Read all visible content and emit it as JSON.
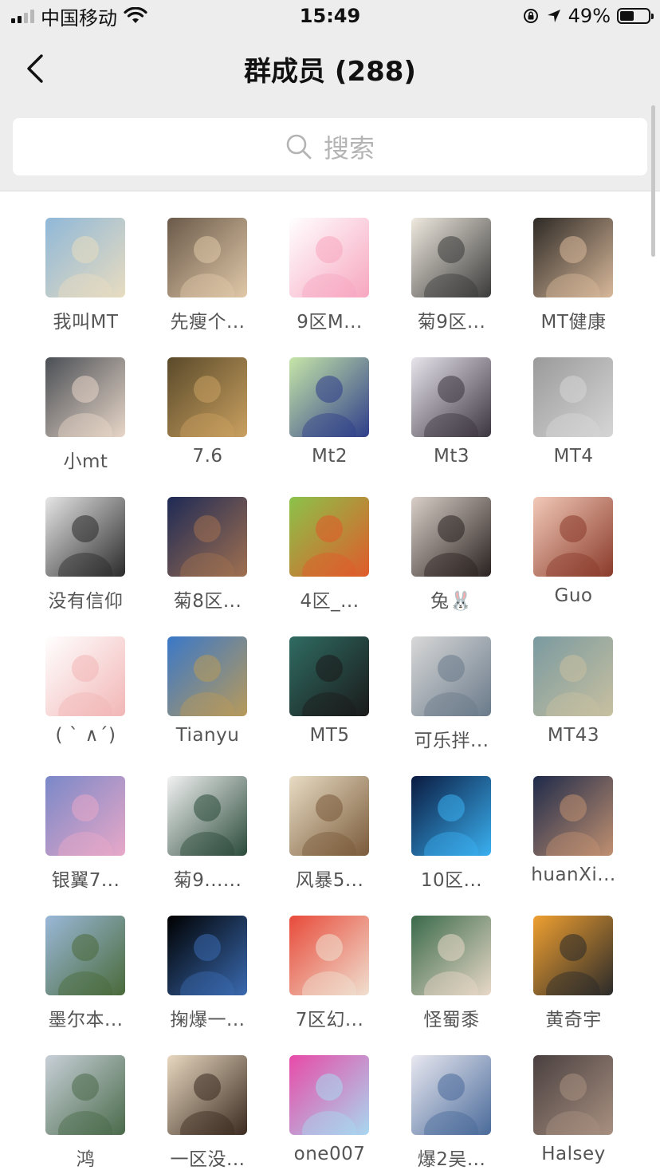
{
  "status_bar": {
    "carrier": "中国移动",
    "time": "15:49",
    "battery": "49%",
    "battery_level": 0.49,
    "signal_bars": 4,
    "signal_active": 2,
    "icons": [
      "signal-icon",
      "wifi-icon",
      "orientation-lock-icon",
      "location-arrow-icon",
      "battery-icon"
    ]
  },
  "nav": {
    "title": "群成员 (288)",
    "back_icon": "chevron-left-icon"
  },
  "search": {
    "placeholder": "搜索",
    "icon": "search-icon"
  },
  "members": [
    {
      "name": "我叫MT",
      "avatar": "white-sports-car",
      "colors": [
        "#8fb8d8",
        "#e8dcc0"
      ]
    },
    {
      "name": "先瘦个...",
      "avatar": "child-at-restaurant",
      "colors": [
        "#6b5a4a",
        "#e0c8a8"
      ]
    },
    {
      "name": "9区M...",
      "avatar": "pink-starfish-cartoon",
      "colors": [
        "#ffffff",
        "#f7a6c0"
      ]
    },
    {
      "name": "菊9区...",
      "avatar": "sleeping-cartoon-kid",
      "colors": [
        "#efe9df",
        "#3a3a3a"
      ]
    },
    {
      "name": "MT健康",
      "avatar": "man-eating-china-flag",
      "colors": [
        "#2e2a26",
        "#d8b89a"
      ]
    },
    {
      "name": "小mt",
      "avatar": "blue-hair-person",
      "colors": [
        "#4a4f55",
        "#e8d6c8"
      ]
    },
    {
      "name": "7.6",
      "avatar": "dog-on-grass",
      "colors": [
        "#5a4a2a",
        "#c9a060"
      ]
    },
    {
      "name": "Mt2",
      "avatar": "police-bear-meme",
      "colors": [
        "#c6e6a8",
        "#2e3d8a"
      ]
    },
    {
      "name": "Mt3",
      "avatar": "anime-character",
      "colors": [
        "#e8e4ec",
        "#3b3540"
      ]
    },
    {
      "name": "MT4",
      "avatar": "bw-man-photo",
      "colors": [
        "#9a9a9a",
        "#d6d6d6"
      ]
    },
    {
      "name": "没有信仰",
      "avatar": "bw-portrait",
      "colors": [
        "#e6e6e6",
        "#2a2a2a"
      ]
    },
    {
      "name": "菊8区...",
      "avatar": "person-on-stairs",
      "colors": [
        "#1e2a55",
        "#a07050"
      ]
    },
    {
      "name": "4区_...",
      "avatar": "straw-hat-on-grass",
      "colors": [
        "#8bc34a",
        "#e05a2a"
      ]
    },
    {
      "name": "兔🐰",
      "avatar": "girl-with-braids",
      "colors": [
        "#d9cfc8",
        "#2a2220"
      ]
    },
    {
      "name": "Guo",
      "avatar": "anime-girl-sticker",
      "colors": [
        "#f2c9b8",
        "#8a3a2a"
      ]
    },
    {
      "name": "( ` ∧´)",
      "avatar": "cartoon-pig",
      "colors": [
        "#ffffff",
        "#f2b6b6"
      ]
    },
    {
      "name": "Tianyu",
      "avatar": "sandstone-building",
      "colors": [
        "#3a78c8",
        "#b89a5a"
      ]
    },
    {
      "name": "MT5",
      "avatar": "anime-boy",
      "colors": [
        "#2f6b62",
        "#1a1a1a"
      ]
    },
    {
      "name": "可乐拌...",
      "avatar": "person-with-mask",
      "colors": [
        "#d8d8d8",
        "#6a7a8a"
      ]
    },
    {
      "name": "MT43",
      "avatar": "person-on-cliff-sea",
      "colors": [
        "#7a9aa0",
        "#c8c0a0"
      ]
    },
    {
      "name": "银翼7...",
      "avatar": "green-cartoon-character",
      "colors": [
        "#7a88c8",
        "#e8a8c8"
      ]
    },
    {
      "name": "菊9......",
      "avatar": "joker-illustration",
      "colors": [
        "#f2f2f2",
        "#2a4a3a"
      ]
    },
    {
      "name": "风暴5...",
      "avatar": "man-with-camera",
      "colors": [
        "#e8dcc4",
        "#7a5a3a"
      ]
    },
    {
      "name": "10区...",
      "avatar": "blue-water-china-flag",
      "colors": [
        "#0a1a40",
        "#3ab0f0"
      ]
    },
    {
      "name": "huanXi...",
      "avatar": "night-clouds-moon",
      "colors": [
        "#1e2a4a",
        "#c09070"
      ]
    },
    {
      "name": "墨尔本...",
      "avatar": "white-car-field",
      "colors": [
        "#9ab8d8",
        "#4a6a3a"
      ]
    },
    {
      "name": "掬爆一...",
      "avatar": "earth-from-space",
      "colors": [
        "#000000",
        "#3a6ab0"
      ]
    },
    {
      "name": "7区幻...",
      "avatar": "child-red-background",
      "colors": [
        "#e84a3a",
        "#f0e0d0"
      ]
    },
    {
      "name": "怪蜀黍",
      "avatar": "glasses-man-drawing",
      "colors": [
        "#3a6a4a",
        "#e8d8c8"
      ]
    },
    {
      "name": "黄奇宇",
      "avatar": "black-cat-sunburst",
      "colors": [
        "#f0a030",
        "#2a2a2a"
      ]
    },
    {
      "name": "鸿",
      "avatar": "park-bridge",
      "colors": [
        "#c8d0d8",
        "#4a6a4a"
      ]
    },
    {
      "name": "一区没...",
      "avatar": "two-kids-back",
      "colors": [
        "#e8d8c0",
        "#3a2a20"
      ]
    },
    {
      "name": "one007",
      "avatar": "rick-cartoon",
      "colors": [
        "#e84aa8",
        "#a8d8f0"
      ]
    },
    {
      "name": "爆2吴...",
      "avatar": "sleeping-baby",
      "colors": [
        "#e8e8f0",
        "#4a6a9a"
      ]
    },
    {
      "name": "Halsey",
      "avatar": "person-in-room",
      "colors": [
        "#4a4040",
        "#a89080"
      ]
    }
  ]
}
